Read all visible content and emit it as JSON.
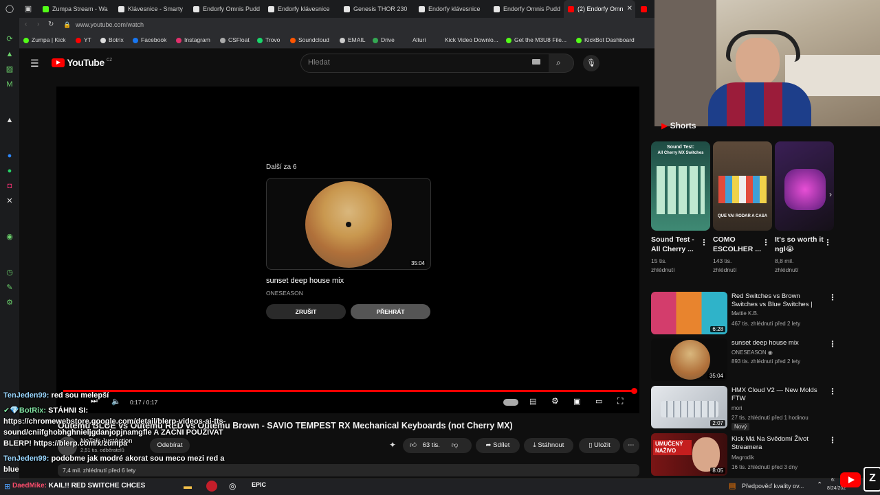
{
  "browser": {
    "tabs": [
      {
        "label": "Zumpa Stream - Wa"
      },
      {
        "label": "Klávesnice - Smarty"
      },
      {
        "label": "Endorfy Omnis Pudd"
      },
      {
        "label": "Endorfy klávesnice"
      },
      {
        "label": "Genesis THOR 230"
      },
      {
        "label": "Endorfy klávesnice"
      },
      {
        "label": "Endorfy Omnis Pudd"
      },
      {
        "label": "(2) Endorfy Omn"
      }
    ],
    "url": "www.youtube.com/watch",
    "bookmarks": [
      {
        "label": "Zumpa | Kick",
        "color": "#53fc18"
      },
      {
        "label": "YT",
        "color": "#ff0000"
      },
      {
        "label": "Botrix",
        "color": "#dddddd"
      },
      {
        "label": "Facebook",
        "color": "#1877f2"
      },
      {
        "label": "Instagram",
        "color": "#e1306c"
      },
      {
        "label": "CSFloat",
        "color": "#aaaaaa"
      },
      {
        "label": "Trovo",
        "color": "#19d66b"
      },
      {
        "label": "Soundcloud",
        "color": "#ff5500"
      },
      {
        "label": "EMAIL",
        "color": "#cccccc"
      },
      {
        "label": "Drive",
        "color": "#34a853"
      },
      {
        "label": "Alturi",
        "color": "#888888"
      },
      {
        "label": "Kick Video Downlo...",
        "color": "#888888"
      },
      {
        "label": "Get the M3U8 File...",
        "color": "#53fc18"
      },
      {
        "label": "KickBot Dashboard",
        "color": "#53fc18"
      }
    ]
  },
  "youtube": {
    "logo_text": "YouTube",
    "region": "CZ",
    "search_placeholder": "Hledat",
    "up_next": {
      "label": "Další za 6",
      "duration": "35:04",
      "title": "sunset deep house mix",
      "channel": "ONESEASON",
      "cancel_label": "ZRUŠIT",
      "play_label": "PŘEHRÁT"
    },
    "player": {
      "time": "0:17 / 0:17",
      "progress": 1.0
    },
    "video": {
      "title": "Outemu BLUE vs Outemu RED vs Outemu Brown - SAVIO TEMPEST RX Mechanical Keyboards (not Cherry MX)",
      "channel": "NoTalk JustAction",
      "subscribers": "2,51 tis. odběratelů",
      "subscribe_label": "Odebírat",
      "likes": "63 tis.",
      "share_label": "Sdílet",
      "download_label": "Stáhnout",
      "save_label": "Uložit",
      "views": "7,4 mil. zhlédnutí  před 6 lety"
    },
    "shorts_header": "Shorts",
    "shorts": [
      {
        "title": "Sound Test - All Cherry ...",
        "views": "15 tis.",
        "views2": "zhlédnutí",
        "thumb_top": "Sound Test:",
        "thumb_sub": "All Cherry MX Switches",
        "color": "#2a6b5a"
      },
      {
        "title": "COMO ESCOLHER ...",
        "views": "143 tis.",
        "views2": "zhlédnutí",
        "thumb_top": "QUE VAI RODAR A CASA",
        "color": "#6a4a3a"
      },
      {
        "title": "It's so worth it ngl😭",
        "views": "8,8 mil.",
        "views2": "zhlédnutí",
        "color": "#2a1a3a"
      }
    ],
    "related": [
      {
        "title": "Red Switches vs Brown Switches vs Blue Switches | ...",
        "channel": "Mattie K.B.",
        "meta": "467 tis. zhlédnutí  před 2 lety",
        "duration": "6:28",
        "color": "#d33d6c"
      },
      {
        "title": "sunset deep house mix",
        "channel": "ONESEASON",
        "meta": "893 tis. zhlédnutí  před 2 lety",
        "duration": "35:04",
        "color": "#0c0c0c"
      },
      {
        "title": "HMX Cloud V2 — New Molds FTW",
        "channel": "mori",
        "meta": "27 tis. zhlédnutí  před 1 hodinou",
        "badge": "Nový",
        "duration": "2:07",
        "color": "#c8cdd2"
      },
      {
        "title": "Kick Má Na Svědomí Život Streamera",
        "channel": "Magrodik",
        "meta": "16 tis. zhlédnutí  před 3 dny",
        "duration": "8:05",
        "thumb_text": "UMUČENÝ NAŽIVO",
        "color": "#8a1f1f"
      }
    ]
  },
  "chat": [
    {
      "user": "TenJeden99:",
      "text": "red sou melepší"
    },
    {
      "user": "✔💎BotRix:",
      "text": "STÁHNI SI:"
    },
    {
      "user": "",
      "text": "https://chromewebstore.google.com/detail/blerp-videos-ai-tts-"
    },
    {
      "user": "",
      "text": "sound/cniifghobhghnieljgdanjopjnamgfle A ZAČNI POUŽÍVAT"
    },
    {
      "user": "",
      "text": "BLERP! https://blerp.com/x/zumpa"
    },
    {
      "user": "TenJeden99:",
      "text": "podobme jak modré akorat sou meco mezi red a"
    },
    {
      "user": "",
      "text": "blue"
    }
  ],
  "taskbar": {
    "ticker": "KAIL!! RED SWITCHE CHCES",
    "ticker_user": "DaedMike:",
    "weather": "Předpověď kvality ov...",
    "clock_time": "6:",
    "clock_date": "8/24/202"
  },
  "colors": {
    "accent": "#ff0000",
    "bg": "#0f0f0f",
    "kick": "#53fc18"
  }
}
